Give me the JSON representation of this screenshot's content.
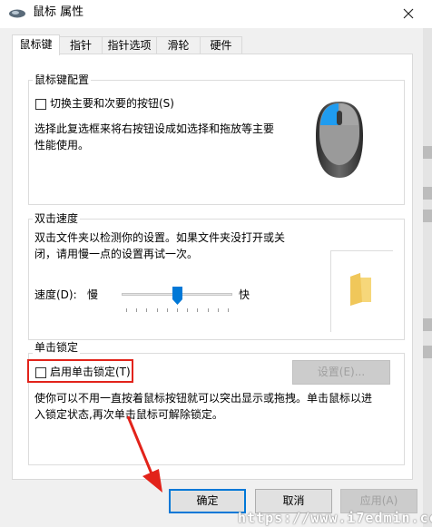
{
  "window": {
    "title": "鼠标 属性",
    "close_glyph": "✕"
  },
  "tabs": [
    {
      "label": "鼠标键",
      "active": true
    },
    {
      "label": "指针",
      "active": false
    },
    {
      "label": "指针选项",
      "active": false
    },
    {
      "label": "滑轮",
      "active": false
    },
    {
      "label": "硬件",
      "active": false
    }
  ],
  "button_config": {
    "title": "鼠标键配置",
    "checkbox_label": "切换主要和次要的按钮(S)",
    "checked": false,
    "description_line1": "选择此复选框来将右按钮设成如选择和拖放等主要",
    "description_line2": "性能使用。",
    "mouse_icon": "mouse-icon"
  },
  "double_click": {
    "title": "双击速度",
    "description_line1": "双击文件夹以检测你的设置。如果文件夹没打开或关",
    "description_line2": "闭，请用慢一点的设置再试一次。",
    "speed_label": "速度(D):",
    "slow_label": "慢",
    "fast_label": "快",
    "speed_level_fraction": 0.5,
    "folder_icon": "folder-icon"
  },
  "click_lock": {
    "title": "单击锁定",
    "checkbox_label": "启用单击锁定(T)",
    "checked": false,
    "settings_button": "设置(E)...",
    "description_line1": "使你可以不用一直按着鼠标按钮就可以突出显示或拖拽。单击鼠标以进",
    "description_line2": "入锁定状态,再次单击鼠标可解除锁定。"
  },
  "footer": {
    "ok": "确定",
    "cancel": "取消",
    "apply": "应用(A)"
  },
  "watermark": "https://www.i7edmin.cc",
  "colors": {
    "accent": "#0078d7",
    "highlight": "#e2231a"
  }
}
